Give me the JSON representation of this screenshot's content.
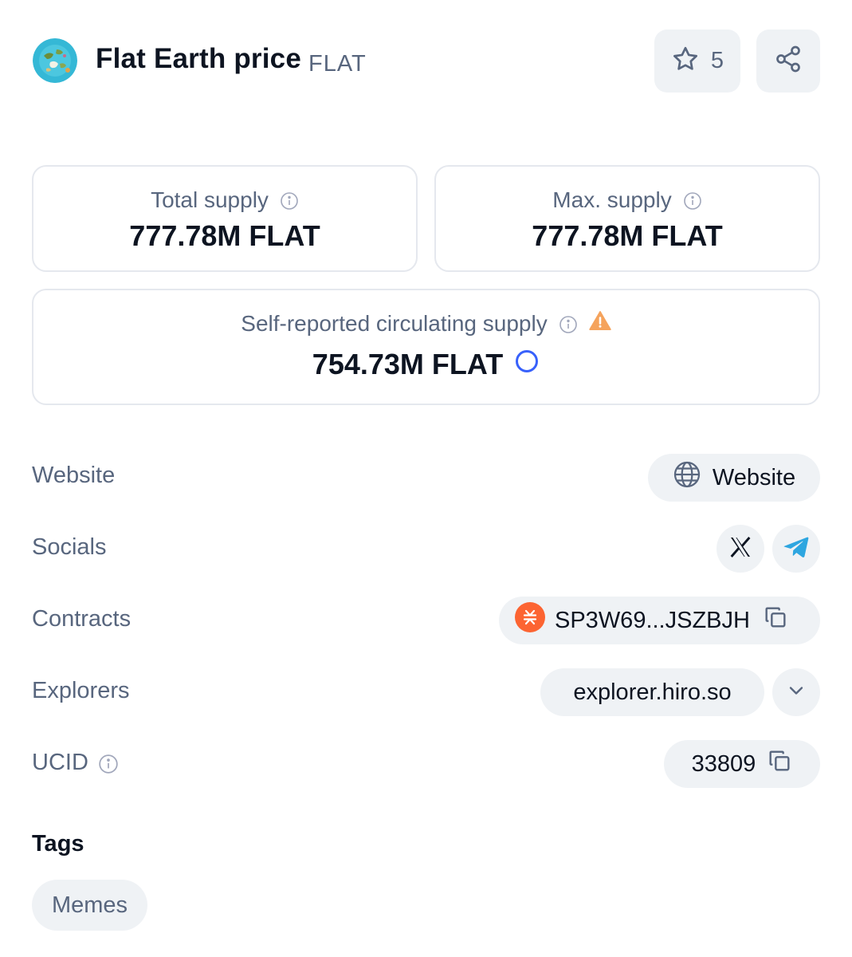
{
  "header": {
    "title": "Flat Earth price",
    "symbol": "FLAT",
    "watchlist_count": "5",
    "icons": {
      "logo": "flat-earth-logo",
      "watchlist": "star-icon",
      "share": "share-icon"
    }
  },
  "supply": {
    "total": {
      "label": "Total supply",
      "value": "777.78M FLAT"
    },
    "max": {
      "label": "Max. supply",
      "value": "777.78M FLAT"
    },
    "circulating": {
      "label": "Self-reported circulating supply",
      "value": "754.73M FLAT"
    }
  },
  "info": {
    "website": {
      "label": "Website",
      "button": "Website"
    },
    "socials": {
      "label": "Socials",
      "items": [
        "x-icon",
        "telegram-icon"
      ]
    },
    "contracts": {
      "label": "Contracts",
      "address": "SP3W69...JSZBJH",
      "chain_icon": "stacks-icon"
    },
    "explorers": {
      "label": "Explorers",
      "value": "explorer.hiro.so"
    },
    "ucid": {
      "label": "UCID",
      "value": "33809"
    }
  },
  "tags": {
    "heading": "Tags",
    "items": [
      "Memes"
    ]
  },
  "colors": {
    "text_primary": "#0d1421",
    "text_secondary": "#58667e",
    "pill_bg": "#eff2f5",
    "border": "#e5e8ee",
    "warning": "#f5a35c",
    "accent_blue": "#3861fb",
    "telegram": "#2ea6e0",
    "stacks": "#fc6432"
  }
}
